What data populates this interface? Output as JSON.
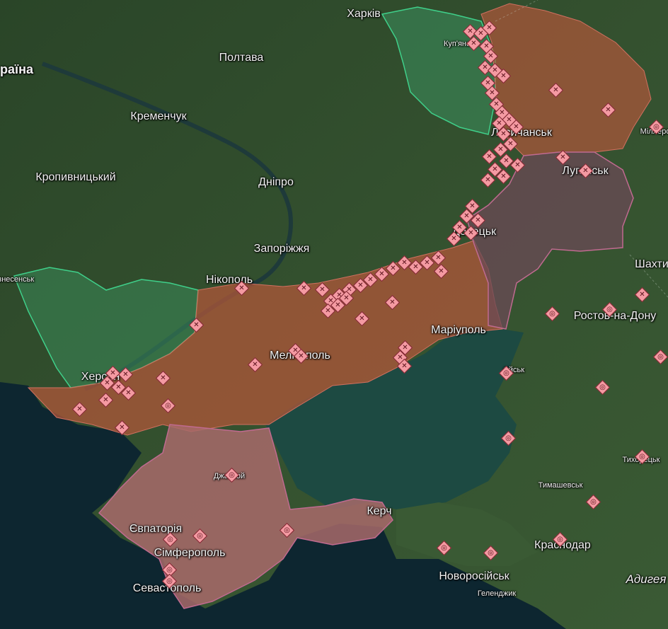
{
  "map": {
    "colors": {
      "land": "#2c4a2c",
      "sea": "#0f2a33",
      "azov_sea": "#1f4a40",
      "occupied_fill": "#b0573a",
      "occupied_crimea": "#a86a6a",
      "occupied_2014": "#6b4a55",
      "liberated_fill": "#3a8a5a",
      "liberated_outline": "#3fd08a",
      "marker": "#f49aa2"
    },
    "icons": {
      "marker_strike": "cross-diamond-icon",
      "marker_target": "target-diamond-icon"
    }
  },
  "labels": {
    "ukraine": "раїна",
    "kharkiv": "Харків",
    "kupiansk": "Куп'янськ",
    "poltava": "Полтава",
    "kremenchuk": "Кременчук",
    "lysychansk": "Лисичанськ",
    "kropyvnytskyi": "Кропивницький",
    "dnipro": "Дніпро",
    "luhansk": "Луганськ",
    "donetsk": "Донецьк",
    "zaporizhzhia": "Запоріжжя",
    "shakhty": "Шахти",
    "nikopol": "Нікополь",
    "voznesensk": "Вознесенськ",
    "rostov": "Ростов-на-Дону",
    "mariupol": "Маріуполь",
    "melitopol": "Мелітополь",
    "kherson": "Херсон",
    "yeysk": "Єйськ",
    "tikhoretsk": "Тихорецьк",
    "timashevsk": "Тимашевськ",
    "dzhankoi": "Джанкой",
    "kerch": "Керч",
    "yevpatoria": "Євпаторія",
    "krasnodar": "Краснодар",
    "simferopol": "Сімферополь",
    "novorossiysk": "Новоросійськ",
    "adygea": "Адигея",
    "sevastopol": "Севастополь",
    "gelendzhik": "Геленджик",
    "millerovo": "Міллерово"
  }
}
